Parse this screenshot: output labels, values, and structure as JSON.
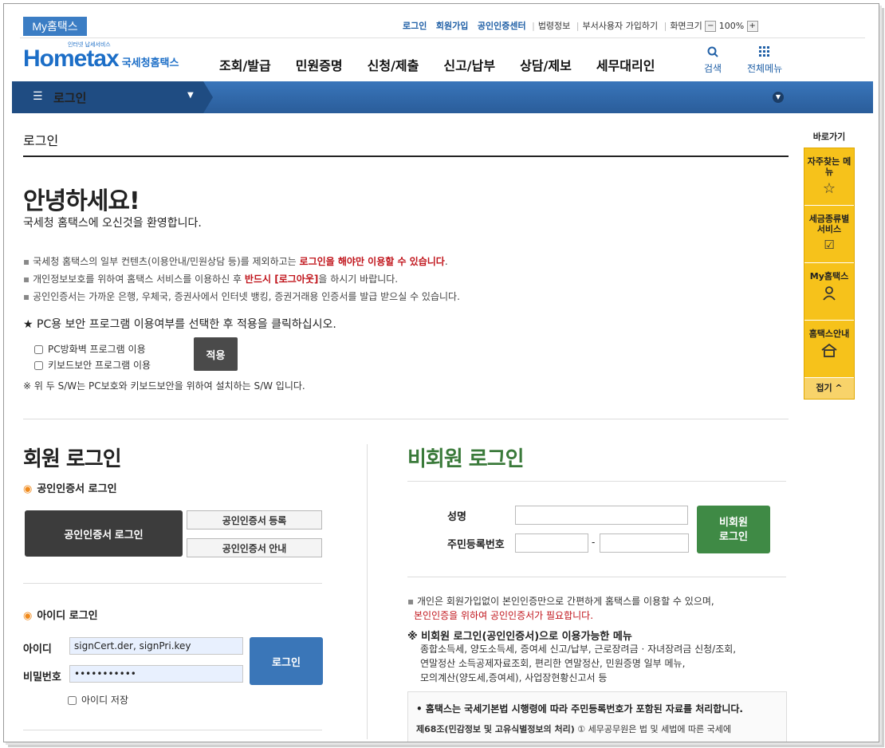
{
  "header": {
    "my_hometax": "My홈택스",
    "links": [
      "로그인",
      "회원가입",
      "공인인증센터",
      "법령정보",
      "부서사용자 가입하기",
      "화면크기"
    ],
    "zoom": "100%",
    "logo_main": "Hometax",
    "logo_sub": "국세청홈택스",
    "logo_tiny": "인터넷 납세서비스",
    "nav": [
      "조회/발급",
      "민원증명",
      "신청/제출",
      "신고/납부",
      "상담/제보",
      "세무대리인"
    ],
    "search_label": "검색",
    "allmenu_label": "전체메뉴"
  },
  "navbar": {
    "current": "로그인"
  },
  "page": {
    "title": "로그인",
    "hello": "안녕하세요!",
    "welcome": "국세청 홈택스에 오신것을 환영합니다.",
    "b1_pre": "국세청 홈택스의 일부 컨텐츠(이용안내/민원상담 등)를 제외하고는 ",
    "b1_red": "로그인을 해야만 이용할 수 있습니다",
    "b1_post": ".",
    "b2_pre": "개인정보보호를 위하여 홈택스 서비스를 이용하신 후 ",
    "b2_red": "반드시 [로그아웃]",
    "b2_post": "을 하시기 바랍니다.",
    "b3": "공인인증서는 가까운 은행, 우체국, 증권사에서 인터넷 뱅킹, 증권거래용 인증서를 발급 받으실 수 있습니다.",
    "pc_title": "★ PC용 보안 프로그램 이용여부를 선택한 후 적용을 클릭하십시오.",
    "chk1": "PC방화벽 프로그램 이용",
    "chk2": "키보드보안 프로그램 이용",
    "apply": "적용",
    "note": "※ 위 두 S/W는 PC보호와 키보드보안을 위하여 설치하는 S/W 입니다."
  },
  "member": {
    "title": "회원 로그인",
    "cert_section": "공인인증서 로그인",
    "cert_login": "공인인증서 로그인",
    "cert_register": "공인인증서 등록",
    "cert_guide": "공인인증서 안내",
    "id_section": "아이디 로그인",
    "id_label": "아이디",
    "id_value": "signCert.der, signPri.key",
    "pw_label": "비밀번호",
    "pw_value": "•••••••••••",
    "login_btn": "로그인",
    "save_id": "아이디 저장"
  },
  "nonmember": {
    "title": "비회원 로그인",
    "name_label": "성명",
    "rrn_label": "주민등록번호",
    "dash": "-",
    "btn_line1": "비회원",
    "btn_line2": "로그인",
    "info1": "개인은 회원가입없이 본인인증만으로 간편하게 홈택스를 이용할 수 있으며,",
    "info2_red": "본인인증을 위하여 공인인증서가 필요합니다.",
    "menu_title": "※ 비회원 로그인(공인인증서)으로 이용가능한 메뉴",
    "menu1": "종합소득세, 양도소득세, 증여세 신고/납부, 근로장려금 · 자녀장려금 신청/조회,",
    "menu2": "연말정산 소득공제자료조회, 편리한 연말정산, 민원증명 일부 메뉴,",
    "menu3": "모의계산(양도세,증여세), 사업장현황신고서 등",
    "law1": "• 홈택스는 국세기본법 시행령에 따라 주민등록번호가 포함된 자료를 처리합니다.",
    "law2_b": "제68조(민감정보 및 고유식별정보의 처리)",
    "law2": " ① 세무공무원은 법 및 세법에 따른 국세에"
  },
  "quick": {
    "title": "바로가기",
    "items": [
      {
        "label": "자주찾는 메뉴",
        "icon": "star-icon"
      },
      {
        "label": "세금종류별 서비스",
        "icon": "checkbox-icon"
      },
      {
        "label": "My홈택스",
        "icon": "user-icon"
      },
      {
        "label": "홈택스안내",
        "icon": "house-icon"
      }
    ],
    "close": "접기 ^"
  },
  "colors": {
    "brand_blue": "#1c6ec7",
    "nav_bar": "#2f68aa",
    "accent_orange": "#f08a1c",
    "nonmember_green": "#3a7a3a",
    "quick_yellow": "#f6c21b",
    "alert_red": "#c0141b"
  }
}
